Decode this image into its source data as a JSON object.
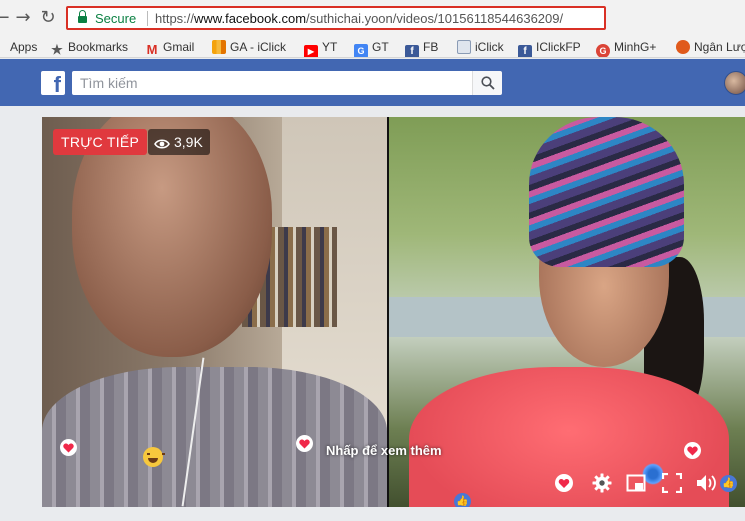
{
  "browser": {
    "secure_label": "Secure",
    "url_scheme": "https://",
    "url_domain": "www.facebook.com",
    "url_path": "/suthichai.yoon/videos/10156118544636209/"
  },
  "bookmarks": [
    {
      "label": "Apps",
      "icon": "apps-grid-icon",
      "color": "#4285f4"
    },
    {
      "label": "Bookmarks",
      "icon": "star-icon",
      "color": "#5a5a5a"
    },
    {
      "label": "Gmail",
      "icon": "gmail-icon",
      "color": "#d93025"
    },
    {
      "label": "GA - iClick",
      "icon": "analytics-icon",
      "color": "#f4a20c"
    },
    {
      "label": "YT",
      "icon": "youtube-icon",
      "color": "#ff0000"
    },
    {
      "label": "GT",
      "icon": "translate-icon",
      "color": "#4285f4"
    },
    {
      "label": "FB",
      "icon": "facebook-icon",
      "color": "#3b5998"
    },
    {
      "label": "iClick",
      "icon": "document-icon",
      "color": "#8a9bb5"
    },
    {
      "label": "IClickFP",
      "icon": "facebook-icon",
      "color": "#3b5998"
    },
    {
      "label": "MinhG+",
      "icon": "google-plus-icon",
      "color": "#db4437"
    },
    {
      "label": "Ngân Lượ",
      "icon": "ngan-luong-icon",
      "color": "#e05a1c"
    }
  ],
  "facebook": {
    "logo_letter": "f",
    "search_placeholder": "Tìm kiếm"
  },
  "video": {
    "live_label": "TRỰC TIẾP",
    "viewer_count": "3,9K",
    "click_hint": "Nhấp để xem thêm"
  },
  "colors": {
    "fb_blue": "#4267b2",
    "live_red": "#e0393e",
    "secure_green": "#0b8043",
    "highlight_red": "#d93025"
  }
}
